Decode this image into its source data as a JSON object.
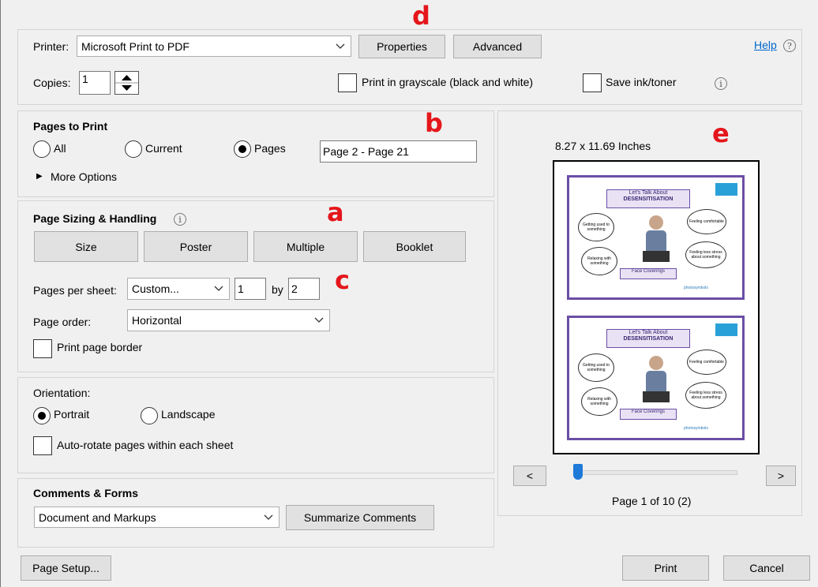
{
  "printer": {
    "label": "Printer:",
    "value": "Microsoft Print to PDF",
    "properties": "Properties",
    "advanced": "Advanced",
    "help": "Help"
  },
  "copies": {
    "label": "Copies:",
    "value": "1"
  },
  "grayscale": "Print in grayscale (black and white)",
  "save_ink": "Save ink/toner",
  "pages_to_print": {
    "title": "Pages to Print",
    "all": "All",
    "current": "Current",
    "pages": "Pages",
    "pages_value": "Page 2 - Page 21",
    "more_options": "More Options"
  },
  "sizing": {
    "title": "Page Sizing & Handling",
    "size": "Size",
    "poster": "Poster",
    "multiple": "Multiple",
    "booklet": "Booklet",
    "pages_per_sheet_label": "Pages per sheet:",
    "pages_per_sheet_value": "Custom...",
    "cols": "1",
    "by": "by",
    "rows": "2",
    "page_order_label": "Page order:",
    "page_order_value": "Horizontal",
    "print_border": "Print page border"
  },
  "orientation": {
    "title": "Orientation:",
    "portrait": "Portrait",
    "landscape": "Landscape",
    "auto_rotate": "Auto-rotate pages within each sheet"
  },
  "comments": {
    "title": "Comments & Forms",
    "value": "Document and Markups",
    "summarize": "Summarize Comments"
  },
  "preview": {
    "size": "8.27 x 11.69 Inches",
    "prev": "<",
    "next": ">",
    "page_status": "Page 1 of 10 (2)",
    "slider_position": 0.0,
    "slide": {
      "title_line1": "Let's Talk About",
      "title_line2": "DESENSITISATION",
      "cloud1": "Getting used to something",
      "cloud2": "Feeling comfortable",
      "cloud3": "Relaxing with something",
      "cloud4": "Feeling less stress about something",
      "footer": "Face Coverings",
      "brand": "photosymbols"
    }
  },
  "footer": {
    "page_setup": "Page Setup...",
    "print": "Print",
    "cancel": "Cancel"
  },
  "markers": {
    "a": "a",
    "b": "b",
    "c": "c",
    "d": "d",
    "e": "e"
  }
}
